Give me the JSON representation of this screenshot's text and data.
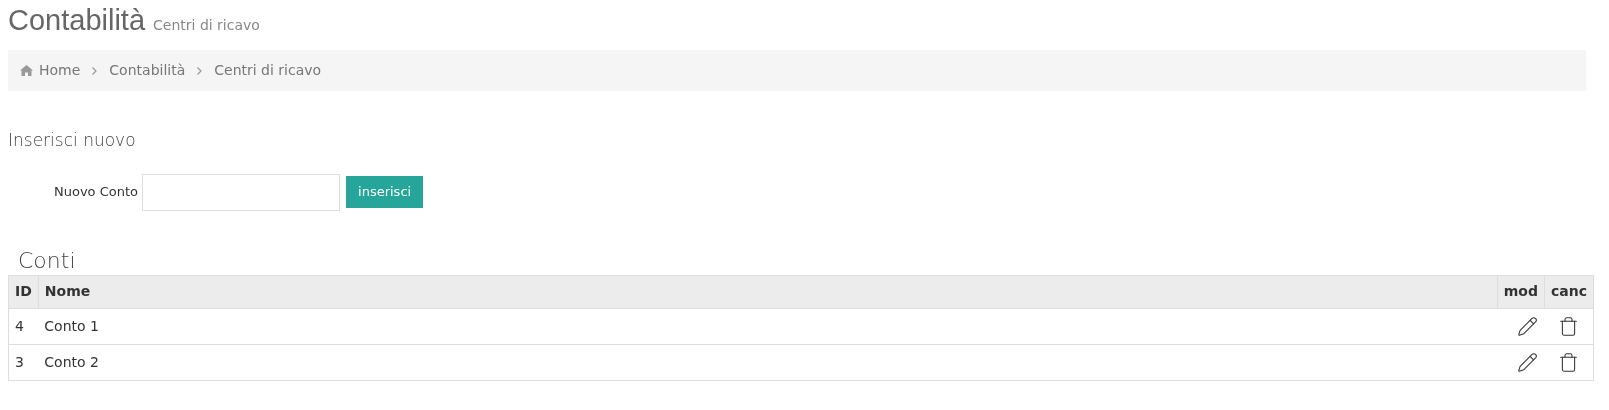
{
  "page_title": "Contabilità",
  "page_subtitle": "Centri di ricavo",
  "breadcrumb": [
    {
      "label": "Home",
      "kind": "home"
    },
    {
      "label": "Contabilità",
      "kind": "link"
    },
    {
      "label": "Centri di ricavo",
      "kind": "current"
    }
  ],
  "insert_section": {
    "title": "Inserisci nuovo",
    "field_label": "Nuovo Conto",
    "button": "inserisci"
  },
  "table": {
    "title": "Conti",
    "columns": [
      "ID",
      "Nome",
      "mod",
      "canc"
    ],
    "rows": [
      {
        "id": "4",
        "name": "Conto 1"
      },
      {
        "id": "3",
        "name": "Conto 2"
      }
    ]
  }
}
